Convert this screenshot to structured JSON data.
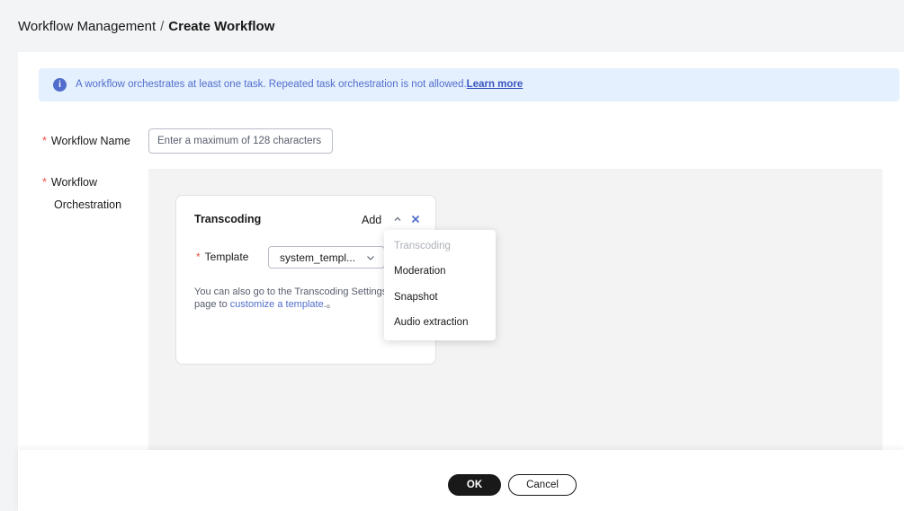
{
  "breadcrumb": {
    "parent": "Workflow Management",
    "separator": "/",
    "current": "Create Workflow"
  },
  "notice": {
    "icon": "info-icon",
    "text": "A workflow orchestrates at least one task. Repeated task orchestration is not allowed.",
    "link": "Learn more"
  },
  "form": {
    "required_mark": "*",
    "name_label": "Workflow Name",
    "name_placeholder": "Enter a maximum of 128 characters",
    "name_value": "",
    "orchestration_label_1": "Workflow",
    "orchestration_label_2": "Orchestration"
  },
  "task": {
    "title": "Transcoding",
    "add_label": "Add",
    "template_label": "Template",
    "template_value": "system_templ...",
    "hint_line1": "You can also go to the Transcoding Settings",
    "hint_line2_prefix": "page to ",
    "hint_link": "customize a template",
    "hint_suffix": ".。"
  },
  "add_menu": {
    "items": [
      {
        "label": "Transcoding",
        "disabled": true
      },
      {
        "label": "Moderation",
        "disabled": false
      },
      {
        "label": "Snapshot",
        "disabled": false
      },
      {
        "label": "Audio extraction",
        "disabled": false
      }
    ]
  },
  "footer": {
    "ok_label": "OK",
    "cancel_label": "Cancel"
  },
  "colors": {
    "accent": "#526ecc",
    "required": "#e84e40",
    "primary_button": "#191919",
    "notice_bg": "#e4f0fe"
  }
}
